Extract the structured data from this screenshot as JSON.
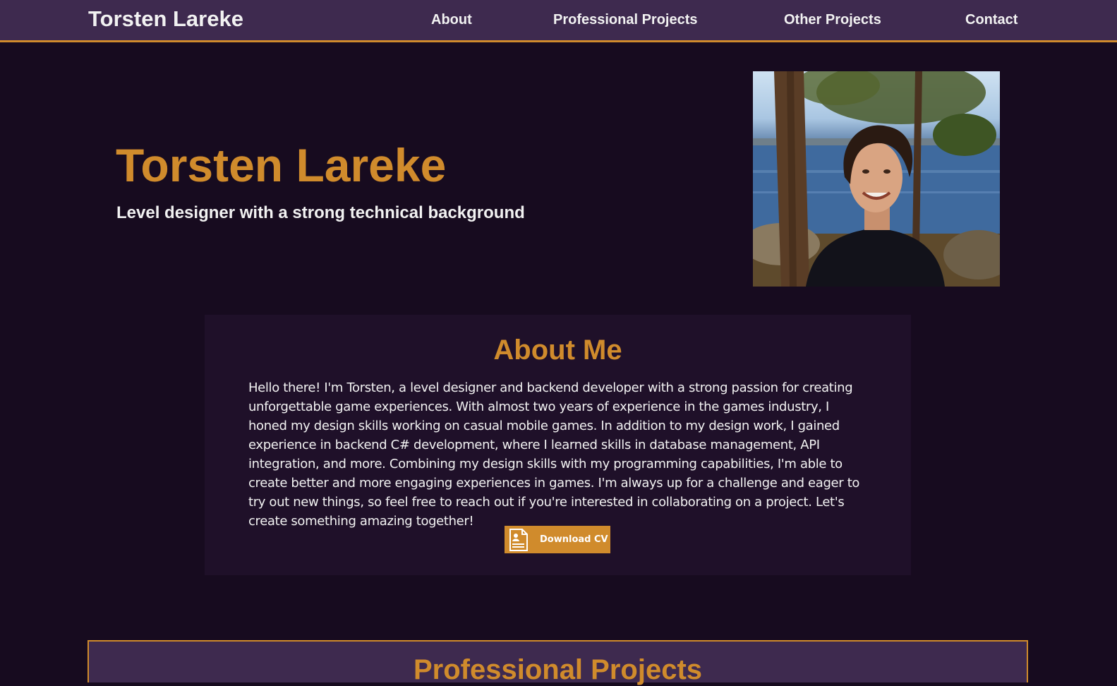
{
  "header": {
    "brand": "Torsten Lareke",
    "nav": [
      "About",
      "Professional Projects",
      "Other Projects",
      "Contact"
    ]
  },
  "hero": {
    "name": "Torsten Lareke",
    "tagline": "Level designer with a strong technical background",
    "photo_icon": "profile-photo"
  },
  "about": {
    "title": "About Me",
    "text": "Hello there! I'm Torsten, a level designer and backend developer with a strong passion for creating unforgettable game experiences. With almost two years of experience in the games industry, I honed my design skills working on casual mobile games. In addition to my design work, I gained experience in backend C# development, where I learned skills in database management, API integration, and more. Combining my design skills with my programming capabilities, I'm able to create better and more engaging experiences in games. I'm always up for a challenge and eager to try out new things, so feel free to reach out if you're interested in collaborating on a project. Let's create something amazing together!",
    "cv_button": "Download CV",
    "cv_icon": "document-icon"
  },
  "projects": {
    "title": "Professional Projects"
  },
  "colors": {
    "accent": "#d08b2c",
    "header_bg": "#3e2a4f",
    "page_bg": "#170b1f",
    "panel_bg": "#1f1029"
  }
}
